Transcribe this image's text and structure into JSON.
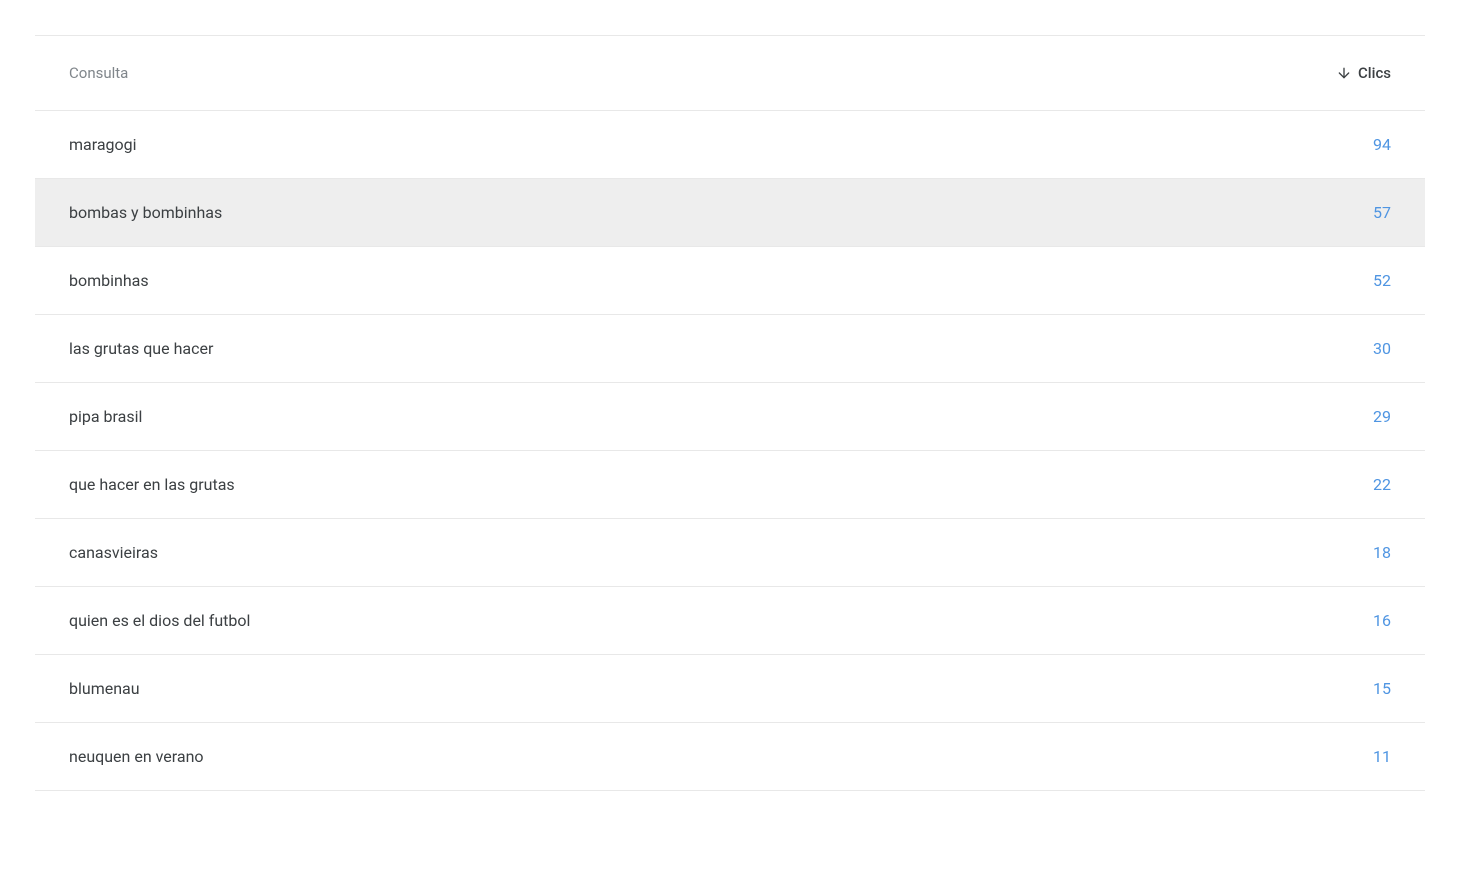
{
  "table": {
    "headers": {
      "query": "Consulta",
      "clicks": "Clics"
    },
    "rows": [
      {
        "query": "maragogi",
        "clicks": "94",
        "highlighted": false
      },
      {
        "query": "bombas y bombinhas",
        "clicks": "57",
        "highlighted": true
      },
      {
        "query": "bombinhas",
        "clicks": "52",
        "highlighted": false
      },
      {
        "query": "las grutas que hacer",
        "clicks": "30",
        "highlighted": false
      },
      {
        "query": "pipa brasil",
        "clicks": "29",
        "highlighted": false
      },
      {
        "query": "que hacer en las grutas",
        "clicks": "22",
        "highlighted": false
      },
      {
        "query": "canasvieiras",
        "clicks": "18",
        "highlighted": false
      },
      {
        "query": "quien es el dios del futbol",
        "clicks": "16",
        "highlighted": false
      },
      {
        "query": "blumenau",
        "clicks": "15",
        "highlighted": false
      },
      {
        "query": "neuquen en verano",
        "clicks": "11",
        "highlighted": false
      }
    ]
  }
}
